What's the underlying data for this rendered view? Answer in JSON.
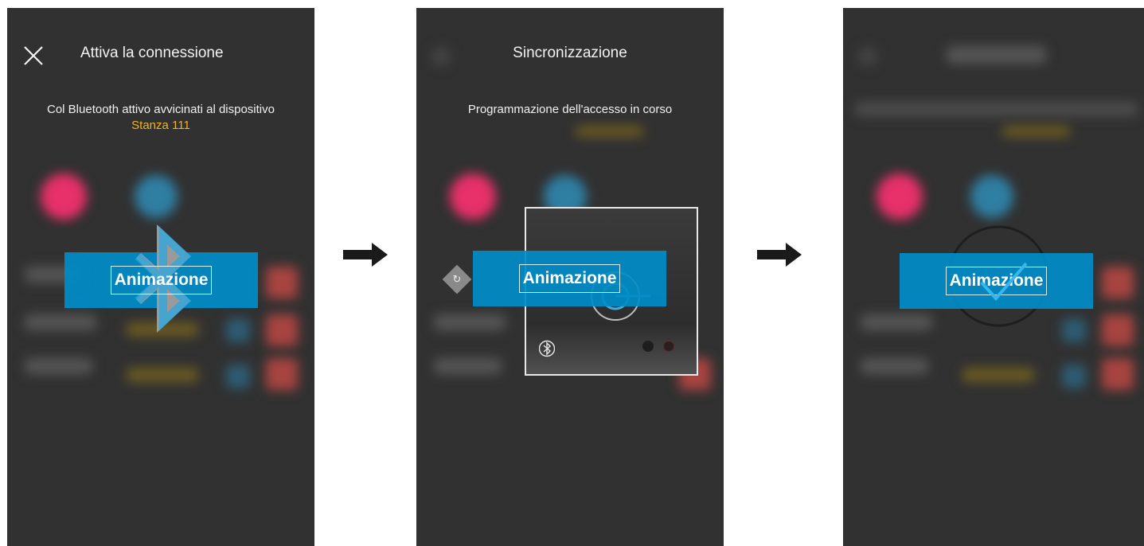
{
  "screens": [
    {
      "title": "Attiva la connessione",
      "message": "Col Bluetooth attivo avvicinati al dispositivo",
      "room": "Stanza 111",
      "banner_label": "Animazione"
    },
    {
      "title": "Sincronizzazione",
      "message": "Programmazione dell'accesso in corso",
      "banner_label": "Animazione"
    },
    {
      "banner_label": "Animazione"
    }
  ],
  "colors": {
    "background": "#313131",
    "accent_room": "#f3b515",
    "banner": "#008cc8",
    "blob_pink": "#e8306a",
    "blob_blue": "#2f8fb5",
    "blob_red": "#c04a44"
  },
  "icons": [
    "close-icon",
    "bluetooth-icon",
    "sync-icon",
    "check-icon",
    "arrow-right-icon"
  ]
}
